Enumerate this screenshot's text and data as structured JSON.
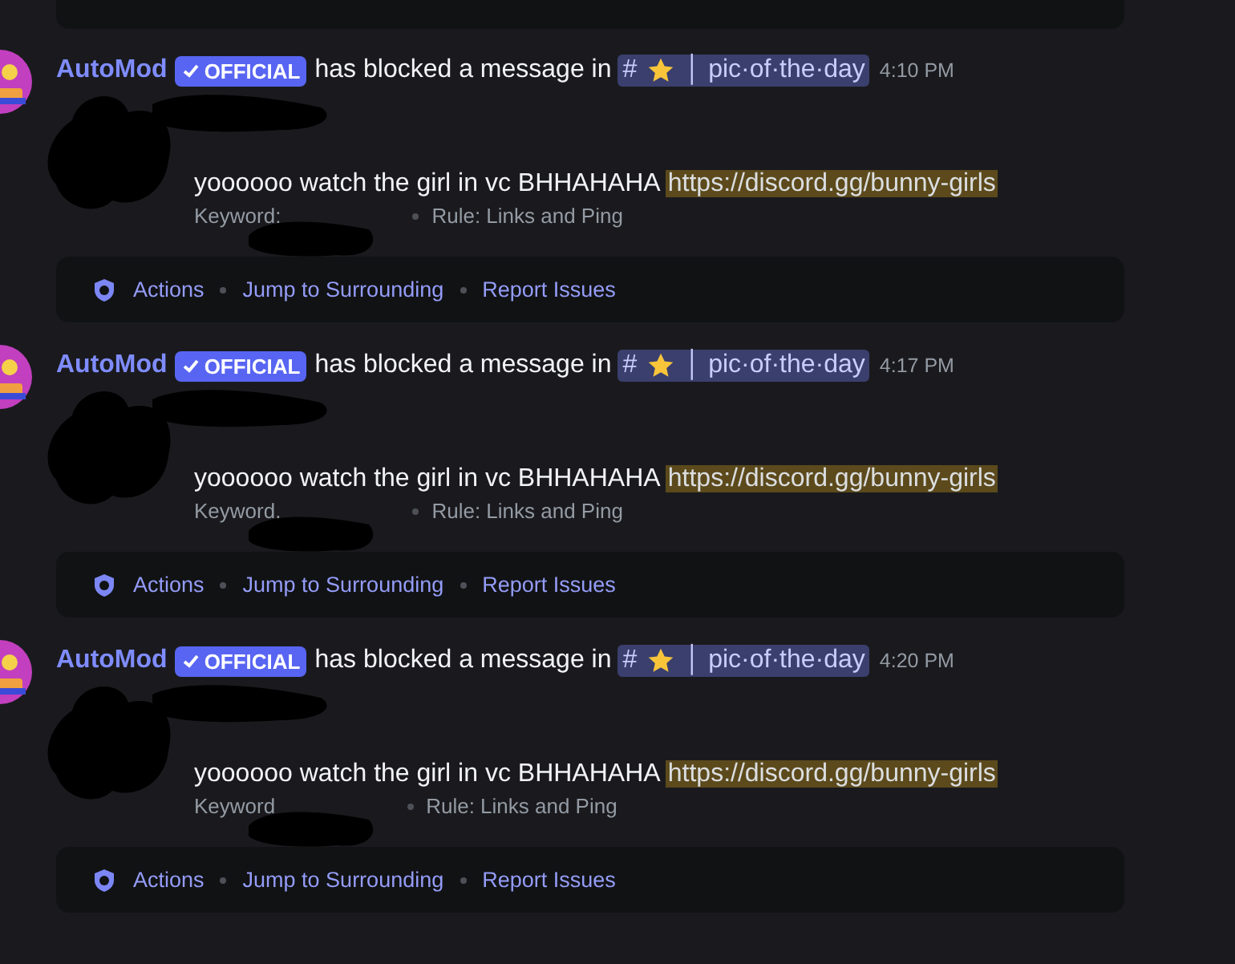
{
  "messages": [
    {
      "author": "AutoMod",
      "badge": "OFFICIAL",
      "action_text": "has blocked a message in",
      "channel": {
        "prefix": "#",
        "name": "│ pic·of·the·day"
      },
      "time": "4:10 PM",
      "content": "yoooooo watch the girl in vc BHHAHAHA",
      "link": "https://discord.gg/bunny-girls",
      "flagged": true,
      "keyword_label": "Keyword:",
      "rule": "Rule: Links and Ping",
      "actions": [
        "Actions",
        "Jump to Surrounding",
        "Report Issues"
      ]
    },
    {
      "author": "AutoMod",
      "badge": "OFFICIAL",
      "action_text": "has blocked a message in",
      "channel": {
        "prefix": "#",
        "name": "│ pic·of·the·day"
      },
      "time": "4:17 PM",
      "content": "yoooooo watch the girl in vc BHHAHAHA",
      "link": "https://discord.gg/bunny-girls",
      "flagged": true,
      "keyword_label": "Keyword.",
      "rule": "Rule: Links and Ping",
      "actions": [
        "Actions",
        "Jump to Surrounding",
        "Report Issues"
      ]
    },
    {
      "author": "AutoMod",
      "badge": "OFFICIAL",
      "action_text": "has blocked a message in",
      "channel": {
        "prefix": "#",
        "name": "│ pic·of·the·day"
      },
      "time": "4:20 PM",
      "content": "yoooooo watch the girl in vc BHHAHAHA",
      "link": "https://discord.gg/bunny-girls",
      "flagged": true,
      "keyword_label": "Keyword",
      "rule": "Rule: Links and Ping",
      "actions": [
        "Actions",
        "Jump to Surrounding",
        "Report Issues"
      ]
    }
  ]
}
